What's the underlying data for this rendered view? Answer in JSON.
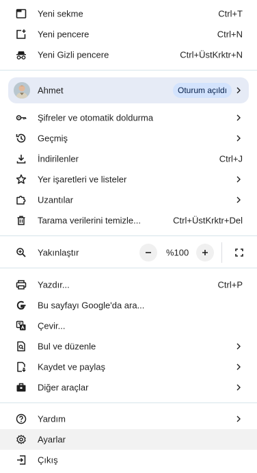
{
  "section1": {
    "new_tab": {
      "label": "Yeni sekme",
      "shortcut": "Ctrl+T",
      "icon": "new-tab-icon"
    },
    "new_window": {
      "label": "Yeni pencere",
      "shortcut": "Ctrl+N",
      "icon": "new-window-icon"
    },
    "incognito": {
      "label": "Yeni Gizli pencere",
      "shortcut": "Ctrl+ÜstKrktr+N",
      "icon": "incognito-icon"
    }
  },
  "profile": {
    "name": "Ahmet",
    "status": "Oturum açıldı",
    "accent": "#e6ebf6",
    "badge_color": "#d3e3fd"
  },
  "section2": {
    "passwords": {
      "label": "Şifreler ve otomatik doldurma",
      "icon": "key-icon"
    },
    "history": {
      "label": "Geçmiş",
      "icon": "history-icon"
    },
    "downloads": {
      "label": "İndirilenler",
      "shortcut": "Ctrl+J",
      "icon": "download-icon"
    },
    "bookmarks": {
      "label": "Yer işaretleri ve listeler",
      "icon": "star-icon"
    },
    "extensions": {
      "label": "Uzantılar",
      "icon": "extension-icon"
    },
    "clear_data": {
      "label": "Tarama verilerini temizle...",
      "shortcut": "Ctrl+ÜstKrktr+Del",
      "icon": "trash-icon"
    }
  },
  "zoom": {
    "label": "Yakınlaştır",
    "value": "%100",
    "icon": "zoom-icon"
  },
  "section3": {
    "print": {
      "label": "Yazdır...",
      "shortcut": "Ctrl+P",
      "icon": "print-icon"
    },
    "google_search": {
      "label": "Bu sayfayı Google'da ara...",
      "icon": "google-icon"
    },
    "translate": {
      "label": "Çevir...",
      "icon": "translate-icon"
    },
    "find_edit": {
      "label": "Bul ve düzenle",
      "icon": "find-icon"
    },
    "save_share": {
      "label": "Kaydet ve paylaş",
      "icon": "save-share-icon"
    },
    "more_tools": {
      "label": "Diğer araçlar",
      "icon": "toolbox-icon"
    }
  },
  "section4": {
    "help": {
      "label": "Yardım",
      "icon": "help-icon"
    },
    "settings": {
      "label": "Ayarlar",
      "icon": "gear-icon"
    },
    "exit": {
      "label": "Çıkış",
      "icon": "exit-icon"
    }
  }
}
